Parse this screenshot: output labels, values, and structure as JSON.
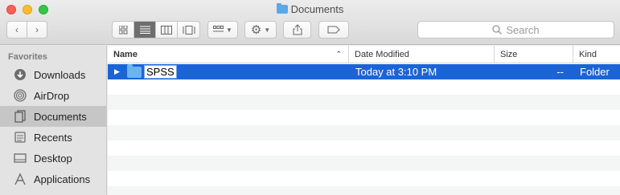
{
  "window": {
    "title": "Documents"
  },
  "toolbar": {
    "search_placeholder": "Search"
  },
  "sidebar": {
    "heading": "Favorites",
    "items": [
      {
        "label": "Downloads",
        "icon": "download-icon"
      },
      {
        "label": "AirDrop",
        "icon": "airdrop-icon"
      },
      {
        "label": "Documents",
        "icon": "documents-icon",
        "active": true
      },
      {
        "label": "Recents",
        "icon": "recents-icon"
      },
      {
        "label": "Desktop",
        "icon": "desktop-icon"
      },
      {
        "label": "Applications",
        "icon": "applications-icon"
      }
    ]
  },
  "list": {
    "columns": {
      "name": "Name",
      "date": "Date Modified",
      "size": "Size",
      "kind": "Kind"
    },
    "rows": [
      {
        "name": "SPSS",
        "date": "Today at 3:10 PM",
        "size": "--",
        "kind": "Folder",
        "selected": true,
        "editing": true
      }
    ]
  },
  "colors": {
    "selection": "#1b64d7",
    "accent_folder": "#69b5f0"
  }
}
